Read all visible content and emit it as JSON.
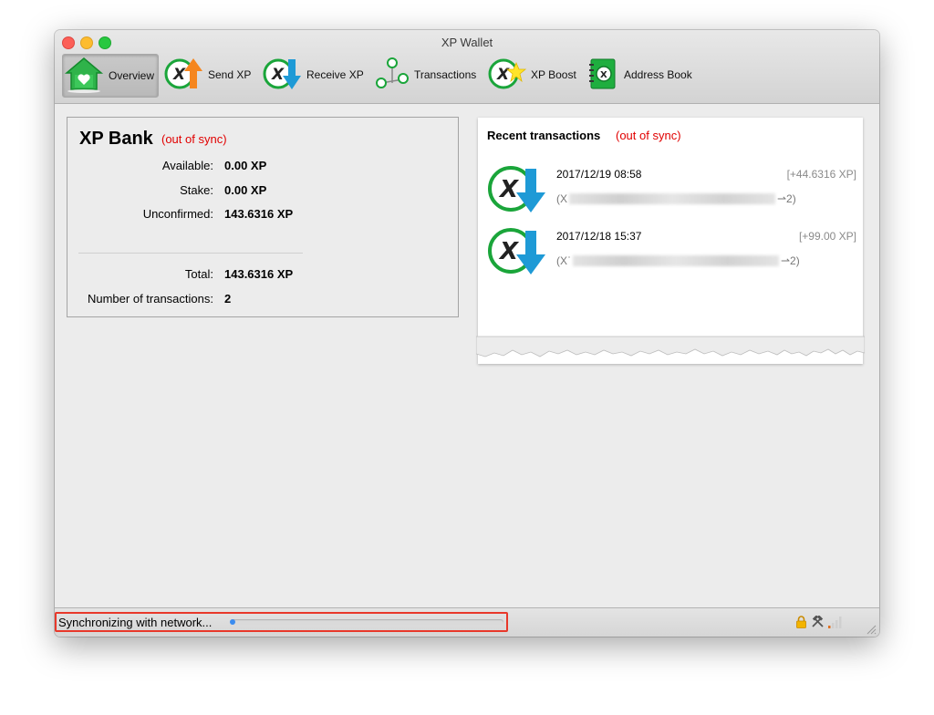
{
  "window": {
    "title": "XP Wallet"
  },
  "toolbar": {
    "overview": "Overview",
    "send": "Send XP",
    "receive": "Receive XP",
    "transactions": "Transactions",
    "boost": "XP Boost",
    "address_book": "Address Book"
  },
  "bank": {
    "title": "XP Bank",
    "sync_status": "(out of sync)",
    "available_label": "Available:",
    "available_value": "0.00 XP",
    "stake_label": "Stake:",
    "stake_value": "0.00 XP",
    "unconfirmed_label": "Unconfirmed:",
    "unconfirmed_value": "143.6316 XP",
    "total_label": "Total:",
    "total_value": "143.6316 XP",
    "tx_count_label": "Number of transactions:",
    "tx_count_value": "2"
  },
  "recent": {
    "title": "Recent transactions",
    "sync_status": "(out of sync)",
    "transactions": [
      {
        "date": "2017/12/19 08:58",
        "amount": "[+44.6316 XP]",
        "addr_start": "(X",
        "addr_end": "⇀2)"
      },
      {
        "date": "2017/12/18 15:37",
        "amount": "[+99.00 XP]",
        "addr_start": "(Xˈ",
        "addr_end": "⇀2)"
      }
    ]
  },
  "status": {
    "text": "Synchronizing with network...",
    "progress": 0.02
  },
  "colors": {
    "accent_red": "#e10000",
    "highlight_box": "#e8382a",
    "progress": "#3b8cf0",
    "xp_green": "#1aa53a"
  }
}
